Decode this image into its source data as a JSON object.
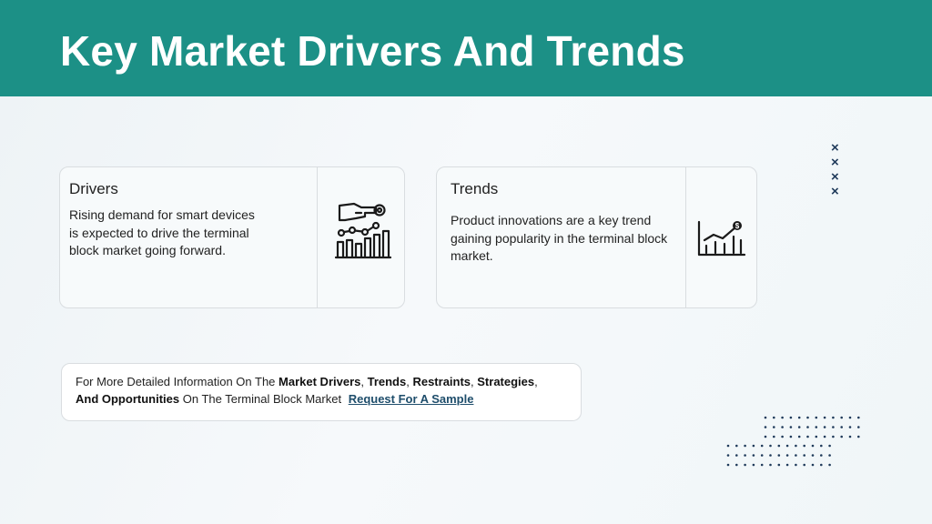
{
  "header": {
    "title": "Key Market Drivers And Trends"
  },
  "drivers_card": {
    "title": "Drivers",
    "body_lines": [
      "Rising demand for smart devices",
      "is expected to drive the terminal",
      "block market going forward."
    ],
    "icon": "hand-gear-chart-icon"
  },
  "trends_card": {
    "title": "Trends",
    "body_lines": [
      "Product innovations are a key trend",
      "gaining popularity in the terminal block",
      "market."
    ],
    "icon": "growth-chart-dollar-icon"
  },
  "info_box": {
    "prefix": "For More Detailed Information On The ",
    "market_drivers": "Market Drivers",
    "comma1": ", ",
    "trends": "Trends",
    "comma2": ", ",
    "restraints": "Restraints",
    "comma3": ", ",
    "strategies": "Strategies",
    "comma4": ",",
    "and_opportunities": "And Opportunities",
    "suffix": " On The Terminal Block Market ",
    "link": "Request For A Sample"
  },
  "decor": {
    "x_mark": "×",
    "accent_color": "#1c9086",
    "mark_color": "#1f3a5a"
  }
}
